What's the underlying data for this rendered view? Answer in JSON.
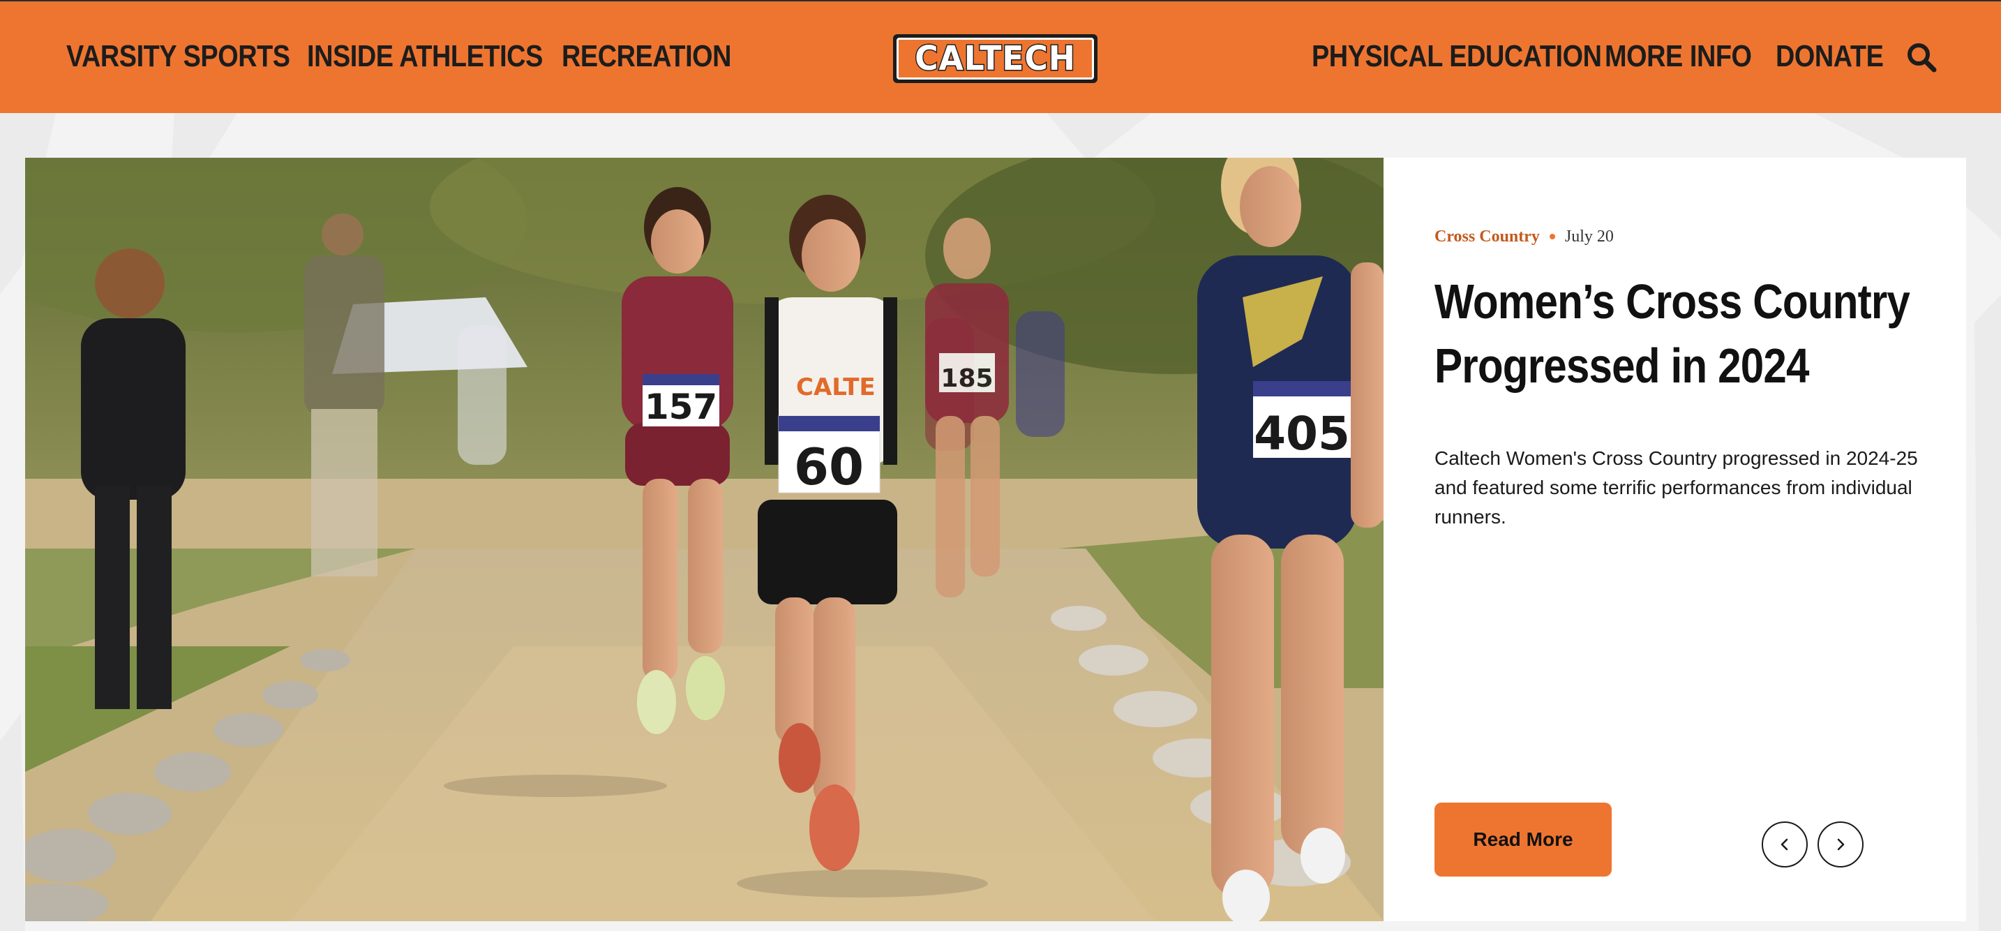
{
  "nav": {
    "left": [
      {
        "label": "VARSITY SPORTS"
      },
      {
        "label": "INSIDE ATHLETICS"
      },
      {
        "label": "RECREATION"
      }
    ],
    "right": [
      {
        "label": "PHYSICAL EDUCATION"
      },
      {
        "label": "MORE INFO"
      },
      {
        "label": "DONATE"
      }
    ],
    "logo_text": "CALTECH",
    "search_icon": "search-icon"
  },
  "story": {
    "category": "Cross Country",
    "date": "July 20",
    "headline": "Women’s Cross Country Progressed in 2024",
    "summary": "Caltech Women's Cross Country progressed in 2024-25 and featured some terrific performances from individual runners.",
    "read_more": "Read More",
    "prev_icon": "chevron-left-icon",
    "next_icon": "chevron-right-icon",
    "bib_numbers": [
      "157",
      "60",
      "405",
      "185"
    ]
  },
  "colors": {
    "brand_orange": "#ee7530",
    "category_text": "#c45a1e",
    "text_dark": "#111111"
  }
}
